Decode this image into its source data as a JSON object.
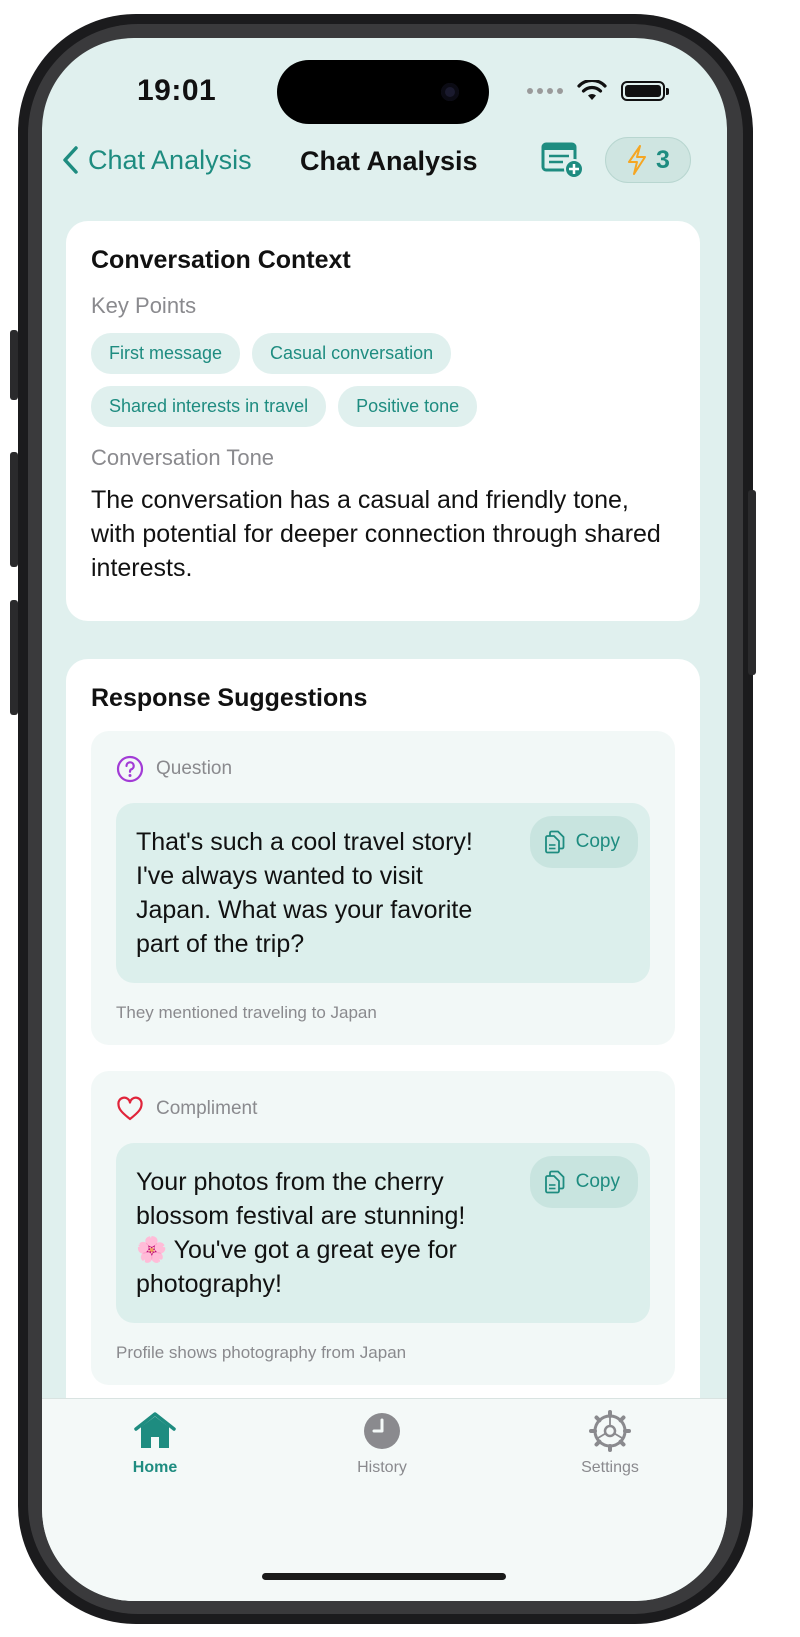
{
  "status_bar": {
    "time": "19:01"
  },
  "nav": {
    "back_label": "Chat Analysis",
    "title": "Chat Analysis",
    "credits": "3",
    "accent": "#1e8c80"
  },
  "context": {
    "title": "Conversation Context",
    "key_points_label": "Key Points",
    "key_points": [
      "First message",
      "Casual conversation",
      "Shared interests in travel",
      "Positive tone"
    ],
    "tone_label": "Conversation Tone",
    "tone_text": "The conversation has a casual and friendly tone, with potential for deeper connection through shared interests."
  },
  "suggestions": {
    "title": "Response Suggestions",
    "items": [
      {
        "category": "Question",
        "icon": "question-circle-icon",
        "text": "That's such a cool travel story! I've always wanted to visit Japan. What was your favorite part of the trip?",
        "copy_label": "Copy",
        "reason": "They mentioned traveling to Japan"
      },
      {
        "category": "Compliment",
        "icon": "heart-icon",
        "text": "Your photos from the cherry blossom festival are stunning! 🌸 You've got a great eye for photography!",
        "copy_label": "Copy",
        "reason": "Profile shows photography from Japan"
      }
    ]
  },
  "tabs": [
    {
      "label": "Home",
      "icon": "house-icon",
      "active": true
    },
    {
      "label": "History",
      "icon": "clock-icon",
      "active": false
    },
    {
      "label": "Settings",
      "icon": "gear-icon",
      "active": false
    }
  ]
}
